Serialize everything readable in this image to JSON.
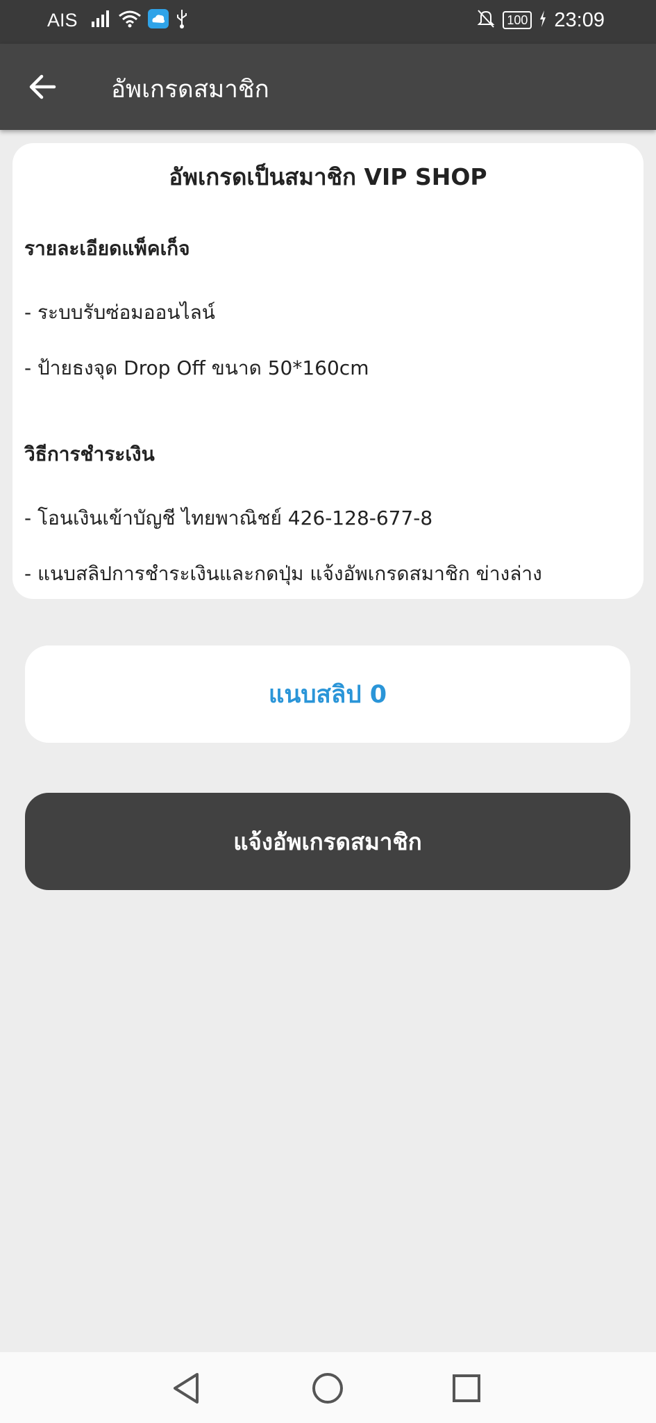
{
  "status_bar": {
    "carrier": "AIS",
    "battery": "100",
    "time": "23:09"
  },
  "app_bar": {
    "title": "อัพเกรดสมาชิก"
  },
  "card": {
    "title": "อัพเกรดเป็นสมาชิก VIP SHOP",
    "package_heading": "รายละเอียดแพ็คเก็จ",
    "package_items": [
      "- ระบบรับซ่อมออนไลน์",
      "- ป้ายธงจุด Drop Off ขนาด 50*160cm"
    ],
    "payment_heading": "วิธีการชำระเงิน",
    "payment_items": [
      "- โอนเงินเข้าบัญชี ไทยพาณิชย์ 426-128-677-8",
      "- แนบสลิปการชำระเงินและกดปุ่ม แจ้งอัพเกรดสมาชิก ข่างล่าง"
    ]
  },
  "attach_button": {
    "label": "แนบสลิป 0"
  },
  "submit_button": {
    "label": "แจ้งอัพเกรดสมาชิก"
  },
  "icons": {
    "back": "arrow-left-icon",
    "signal": "signal-icon",
    "wifi": "wifi-icon",
    "cloud": "cloud-app-icon",
    "usb": "usb-icon",
    "mute": "bell-off-icon",
    "charge": "charging-icon",
    "nav_back": "triangle-back-icon",
    "nav_home": "circle-home-icon",
    "nav_recent": "square-recent-icon"
  },
  "colors": {
    "status_bar": "#3a3a3a",
    "app_bar": "#454545",
    "background": "#ededed",
    "accent_blue": "#2a95d8",
    "submit_button": "#414141"
  }
}
